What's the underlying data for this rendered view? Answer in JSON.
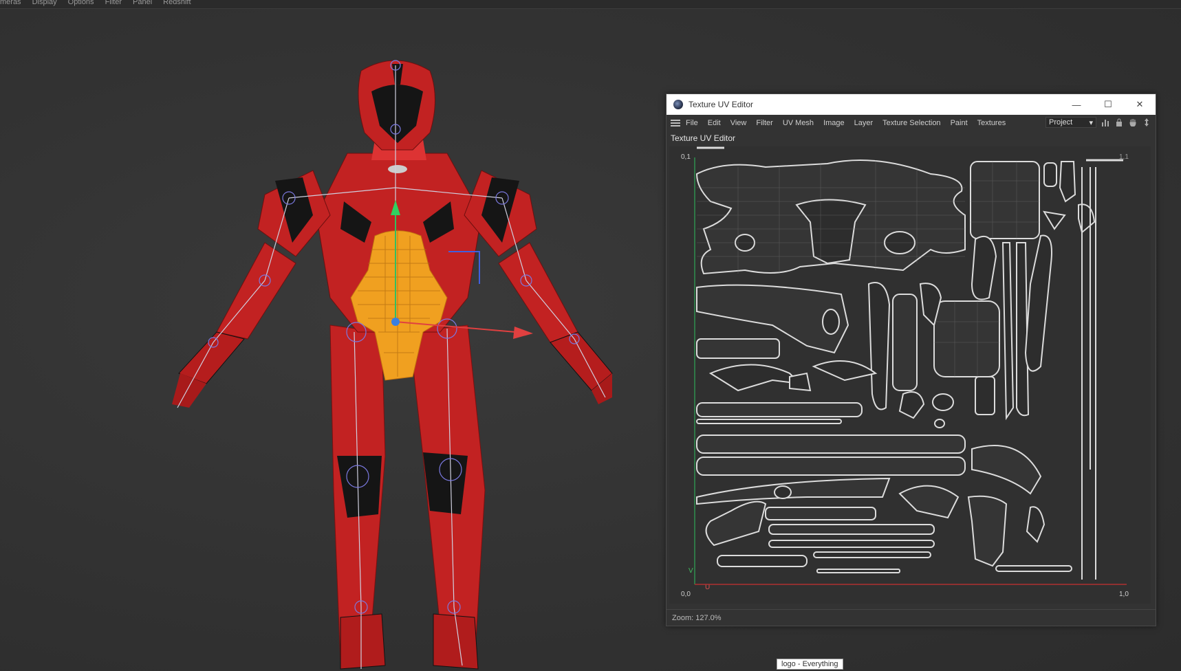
{
  "top_menu": [
    "meras",
    "Display",
    "Options",
    "Filter",
    "Panel",
    "Redshift"
  ],
  "uv_window": {
    "title": "Texture UV Editor",
    "window_buttons": {
      "minimize": "—",
      "maximize": "☐",
      "close": "✕"
    },
    "menus": [
      "File",
      "Edit",
      "View",
      "Filter",
      "UV Mesh",
      "Image",
      "Layer",
      "Texture Selection",
      "Paint",
      "Textures"
    ],
    "project_select": "Project",
    "panel_label": "Texture UV Editor",
    "axis": {
      "top_left": "0,1",
      "bottom_left": "0,0",
      "bottom_right": "1,0",
      "top_right": "1,1",
      "v": "V",
      "u": "U"
    },
    "status": "Zoom: 127.0%"
  },
  "tooltip": "logo - Everything",
  "colors": {
    "viewport_bg": "#313131",
    "armor_red": "#c22222",
    "armor_black": "#151515",
    "selection_orange": "#f0a020",
    "uv_lines": "#dcdcdc"
  }
}
